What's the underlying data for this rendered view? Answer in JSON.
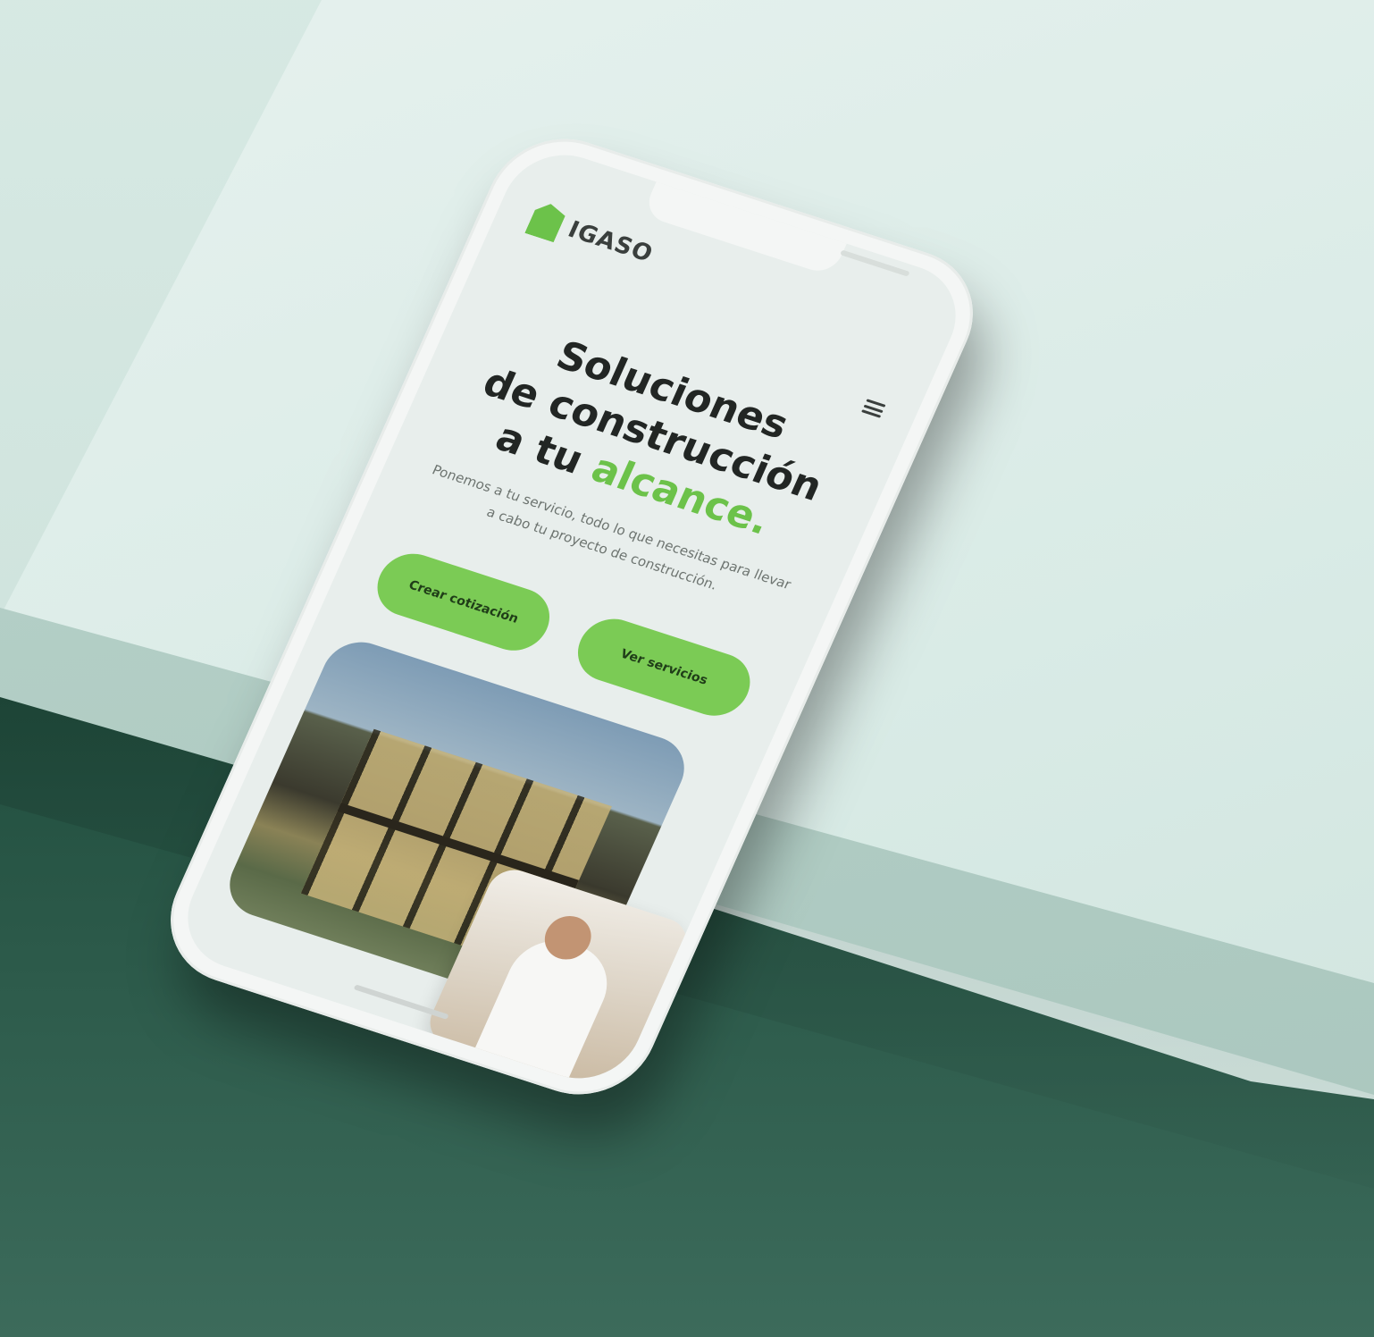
{
  "brand": {
    "logo_text": "IGASO"
  },
  "hero": {
    "headline_line1": "Soluciones",
    "headline_line2": "de construcción",
    "headline_line3_prefix": "a tu ",
    "headline_line3_accent": "alcance.",
    "subtitle": "Ponemos a tu servicio, todo lo que necesitas para llevar a cabo tu proyecto de construcción."
  },
  "buttons": {
    "primary_label": "Crear cotización",
    "secondary_label": "Ver servicios"
  },
  "icons": {
    "menu": "hamburger-menu-icon",
    "logo": "house-logo-icon"
  },
  "colors": {
    "accent": "#6cc24a",
    "button": "#7bcb55",
    "heading": "#222624",
    "screen_bg": "#e8eeec"
  }
}
